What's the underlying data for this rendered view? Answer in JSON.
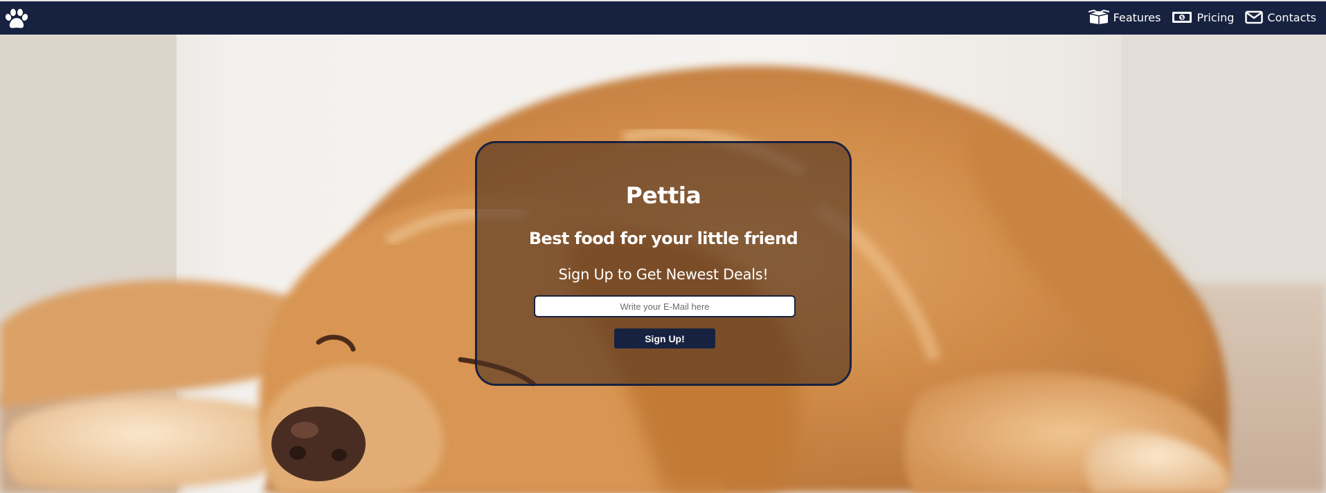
{
  "nav": {
    "logo_icon": "paw-icon",
    "links": [
      {
        "label": "Features",
        "icon": "box-icon"
      },
      {
        "label": "Pricing",
        "icon": "money-icon"
      },
      {
        "label": "Contacts",
        "icon": "envelope-icon"
      }
    ]
  },
  "hero": {
    "image": "golden retriever lying on floor",
    "card": {
      "title": "Pettia",
      "tagline": "Best food for your little friend",
      "cta": "Sign Up to Get Newest Deals!",
      "email_placeholder": "Write your E-Mail here",
      "button_label": "Sign Up!"
    }
  },
  "colors": {
    "navbar": "#172240",
    "card_border": "#172240",
    "button": "#172240",
    "text": "#ffffff"
  }
}
